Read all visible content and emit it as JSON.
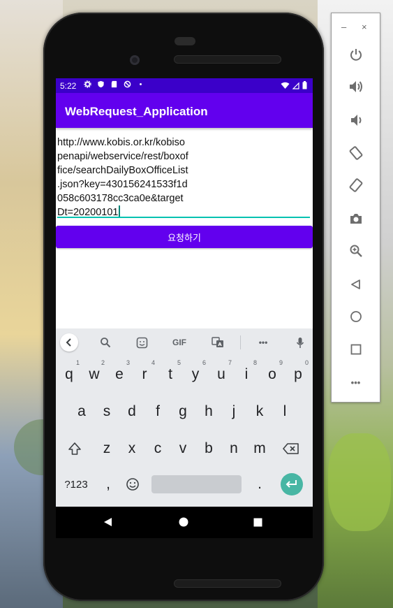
{
  "status_bar": {
    "time": "5:22"
  },
  "app_bar": {
    "title": "WebRequest_Application"
  },
  "url_field": {
    "lines": [
      "http://www.kobis.or.kr/kobiso",
      "penapi/webservice/rest/boxof",
      "fice/searchDailyBoxOfficeList",
      ".json?key=430156241533f1d",
      "058c603178cc3ca0e&target",
      "Dt=20200101"
    ]
  },
  "request_button": {
    "label": "요청하기"
  },
  "keyboard": {
    "toolbar": {
      "gif_label": "GIF",
      "more_label": "•••"
    },
    "row1": [
      "q",
      "w",
      "e",
      "r",
      "t",
      "y",
      "u",
      "i",
      "o",
      "p"
    ],
    "row1_hints": [
      "1",
      "2",
      "3",
      "4",
      "5",
      "6",
      "7",
      "8",
      "9",
      "0"
    ],
    "row2": [
      "a",
      "s",
      "d",
      "f",
      "g",
      "h",
      "j",
      "k",
      "l"
    ],
    "row3": [
      "z",
      "x",
      "c",
      "v",
      "b",
      "n",
      "m"
    ],
    "symbols_label": "?123",
    "comma_label": ",",
    "period_label": "."
  },
  "emulator_panel": {
    "minimize_label": "–",
    "close_label": "×",
    "more_label": "•••"
  }
}
